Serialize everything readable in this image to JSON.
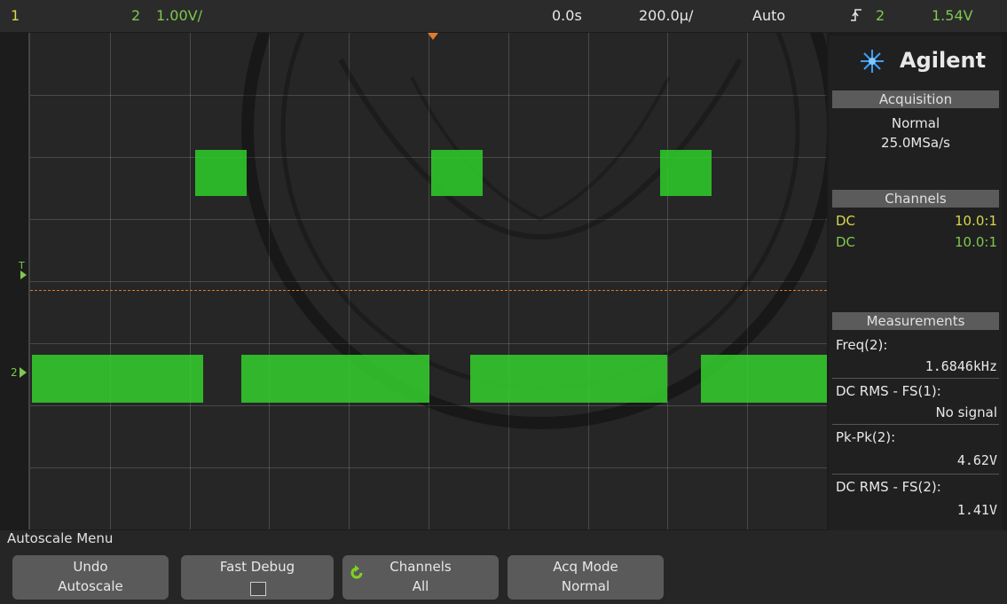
{
  "topbar": {
    "ch1_num": "1",
    "ch2_num": "2",
    "ch2_scale": "1.00V/",
    "time_delay": "0.0s",
    "time_scale": "200.0µ/",
    "trigger_mode": "Auto",
    "trigger_slope_icon": "rising-edge-icon",
    "trigger_source": "2",
    "trigger_level": "1.54V"
  },
  "screen": {
    "trigger_marker": "T",
    "ch2_marker": "2"
  },
  "side_panel": {
    "brand": "Agilent",
    "acquisition": {
      "header": "Acquisition",
      "mode": "Normal",
      "rate": "25.0MSa/s"
    },
    "channels": {
      "header": "Channels",
      "rows": [
        {
          "coupling": "DC",
          "probe": "10.0:1"
        },
        {
          "coupling": "DC",
          "probe": "10.0:1"
        }
      ]
    },
    "measurements": {
      "header": "Measurements",
      "items": [
        {
          "label": "Freq(2):",
          "value": "1.6846kHz"
        },
        {
          "label": "DC RMS - FS(1):",
          "value": "No signal"
        },
        {
          "label": "Pk-Pk(2):",
          "value": "4.62V"
        },
        {
          "label": "DC RMS - FS(2):",
          "value": "1.41V"
        }
      ]
    }
  },
  "menu": {
    "title": "Autoscale Menu",
    "softkeys": [
      {
        "line1": "Undo",
        "line2": "Autoscale"
      },
      {
        "line1": "Fast Debug",
        "line2": ""
      },
      {
        "line1": "Channels",
        "line2": "All"
      },
      {
        "line1": "Acq Mode",
        "line2": "Normal"
      }
    ]
  },
  "colors": {
    "ch1": "#d6d84a",
    "ch2": "#7ec850",
    "trace": "#2fcf2a",
    "trigger_line": "#d97a2a"
  }
}
